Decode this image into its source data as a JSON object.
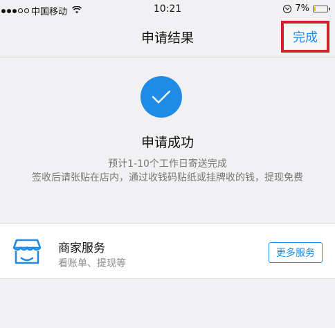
{
  "status_bar": {
    "carrier": "中国移动",
    "time": "10:21",
    "battery": "7%",
    "battery_level": 0.07,
    "battery_color": "#f2c200"
  },
  "nav": {
    "title": "申请结果",
    "done_label": "完成"
  },
  "result": {
    "icon": "check-icon",
    "title": "申请成功",
    "line1": "预计1-10个工作日寄送完成",
    "line2": "签收后请张贴在店内，通过收钱码贴纸或挂牌收的钱，提现免费"
  },
  "service": {
    "icon": "shop-icon",
    "title": "商家服务",
    "subtitle": "看账单、提现等",
    "button_label": "更多服务"
  },
  "colors": {
    "accent": "#1c8ff0",
    "highlight_border": "#d0232b",
    "check_circle": "#1e8ce6"
  }
}
